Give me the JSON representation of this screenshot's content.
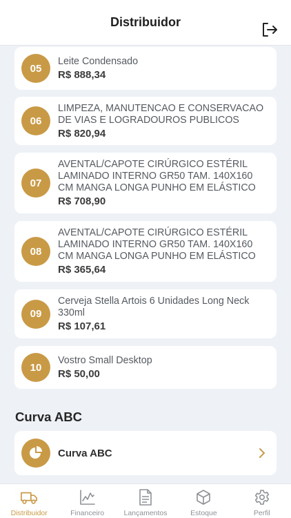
{
  "header": {
    "title": "Distribuidor"
  },
  "products": [
    {
      "rank": "05",
      "name": "Leite Condensado",
      "price": "R$ 888,34"
    },
    {
      "rank": "06",
      "name": "LIMPEZA, MANUTENCAO E CONSERVACAO DE VIAS E LOGRADOUROS PUBLICOS",
      "price": "R$ 820,94"
    },
    {
      "rank": "07",
      "name": "AVENTAL/CAPOTE CIRÚRGICO ESTÉRIL LAMINADO INTERNO GR50 TAM. 140X160 CM MANGA LONGA PUNHO EM ELÁSTICO",
      "price": "R$ 708,90"
    },
    {
      "rank": "08",
      "name": "AVENTAL/CAPOTE CIRÚRGICO ESTÉRIL LAMINADO INTERNO GR50 TAM. 140X160 CM MANGA LONGA PUNHO EM ELÁSTICO",
      "price": "R$ 365,64"
    },
    {
      "rank": "09",
      "name": "Cerveja Stella Artois 6 Unidades Long Neck 330ml",
      "price": "R$ 107,61"
    },
    {
      "rank": "10",
      "name": "Vostro Small Desktop",
      "price": "R$ 50,00"
    }
  ],
  "curva": {
    "section_title": "Curva ABC",
    "item_label": "Curva ABC"
  },
  "tabs": [
    {
      "label": "Distribuidor",
      "icon": "truck-icon",
      "active": true
    },
    {
      "label": "Financeiro",
      "icon": "chart-line-icon",
      "active": false
    },
    {
      "label": "Lançamentos",
      "icon": "document-icon",
      "active": false
    },
    {
      "label": "Estoque",
      "icon": "box-icon",
      "active": false
    },
    {
      "label": "Perfil",
      "icon": "gear-icon",
      "active": false
    }
  ],
  "colors": {
    "accent": "#c99a46",
    "background": "#eef2f6",
    "card": "#ffffff",
    "inactive": "#8e9196"
  }
}
